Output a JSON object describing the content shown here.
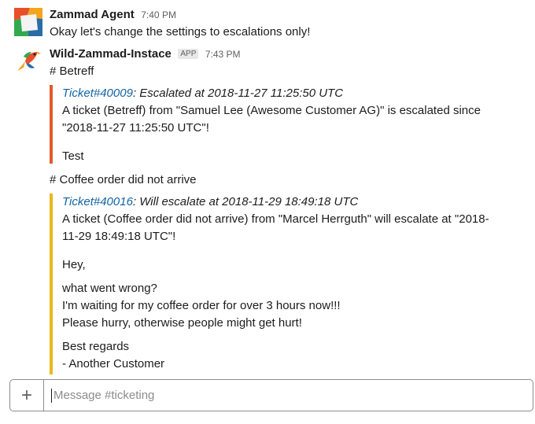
{
  "colors": {
    "escalated_bar": "#e05b2b",
    "warning_bar": "#e8b81c",
    "link": "#1264a3"
  },
  "messages": [
    {
      "sender": "Zammad Agent",
      "time": "7:40 PM",
      "avatar_icon": "zammad-logo-icon",
      "text": "Okay let's change the settings to escalations only!"
    },
    {
      "sender": "Wild-Zammad-Instace",
      "badge": "APP",
      "time": "7:43 PM",
      "avatar_icon": "parrot-bot-icon",
      "sections": [
        {
          "heading": "# Betreff",
          "ticket_link": "Ticket#40009",
          "status": ": Escalated at 2018-11-27 11:25:50 UTC",
          "body_lines": [
            "A ticket (Betreff) from \"Samuel Lee (Awesome Customer AG)\" is escalated since",
            "\"2018-11-27 11:25:50 UTC\"!"
          ],
          "content": [
            "Test"
          ]
        },
        {
          "heading": "# Coffee order did not arrive",
          "ticket_link": "Ticket#40016",
          "status": ": Will escalate at 2018-11-29 18:49:18 UTC",
          "body_lines": [
            "A ticket (Coffee order did not arrive) from \"Marcel Herrguth\" will escalate at \"2018-",
            "11-29 18:49:18 UTC\"!"
          ],
          "content": [
            "Hey,",
            "what went wrong?",
            "I'm waiting for my coffee order for over 3 hours now!!!",
            "Please hurry, otherwise people might get hurt!",
            "Best regards",
            "- Another Customer"
          ]
        }
      ]
    }
  ],
  "composer": {
    "plus_label": "+",
    "placeholder": "Message #ticketing"
  }
}
